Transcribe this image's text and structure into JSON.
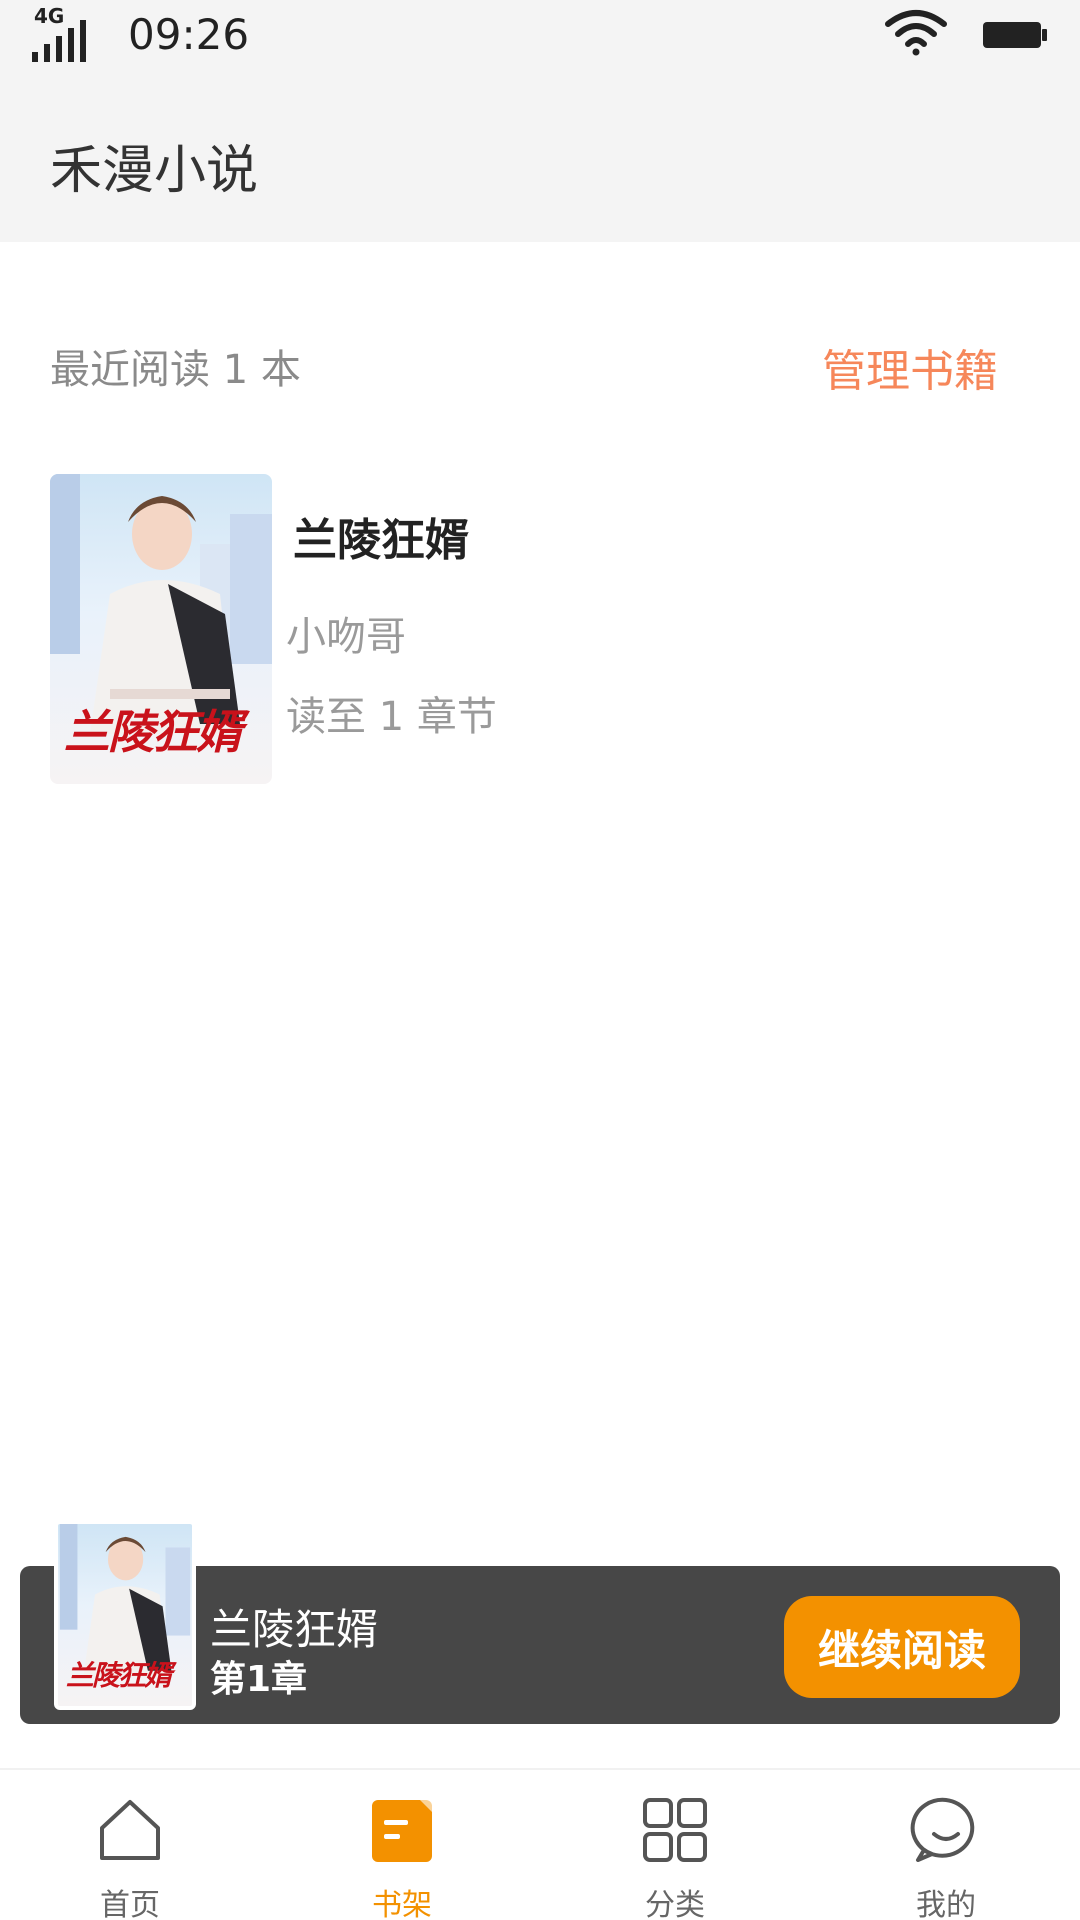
{
  "status": {
    "network": "4G",
    "time": "09:26"
  },
  "header": {
    "title": "禾漫小说"
  },
  "recent": {
    "label": "最近阅读 1 本",
    "manage_label": "管理书籍"
  },
  "book": {
    "title": "兰陵狂婿",
    "author": "小吻哥",
    "progress": "读至 1 章节",
    "cover_title": "兰陵狂婿"
  },
  "continue_bar": {
    "title": "兰陵狂婿",
    "chapter": "第1章",
    "button": "继续阅读"
  },
  "tabs": [
    {
      "label": "首页",
      "icon": "home-icon",
      "active": false
    },
    {
      "label": "书架",
      "icon": "bookshelf-icon",
      "active": true
    },
    {
      "label": "分类",
      "icon": "category-grid-icon",
      "active": false
    },
    {
      "label": "我的",
      "icon": "chat-profile-icon",
      "active": false
    }
  ],
  "colors": {
    "accent": "#f39100",
    "manage": "#f6875a",
    "bar_bg": "#474747"
  }
}
